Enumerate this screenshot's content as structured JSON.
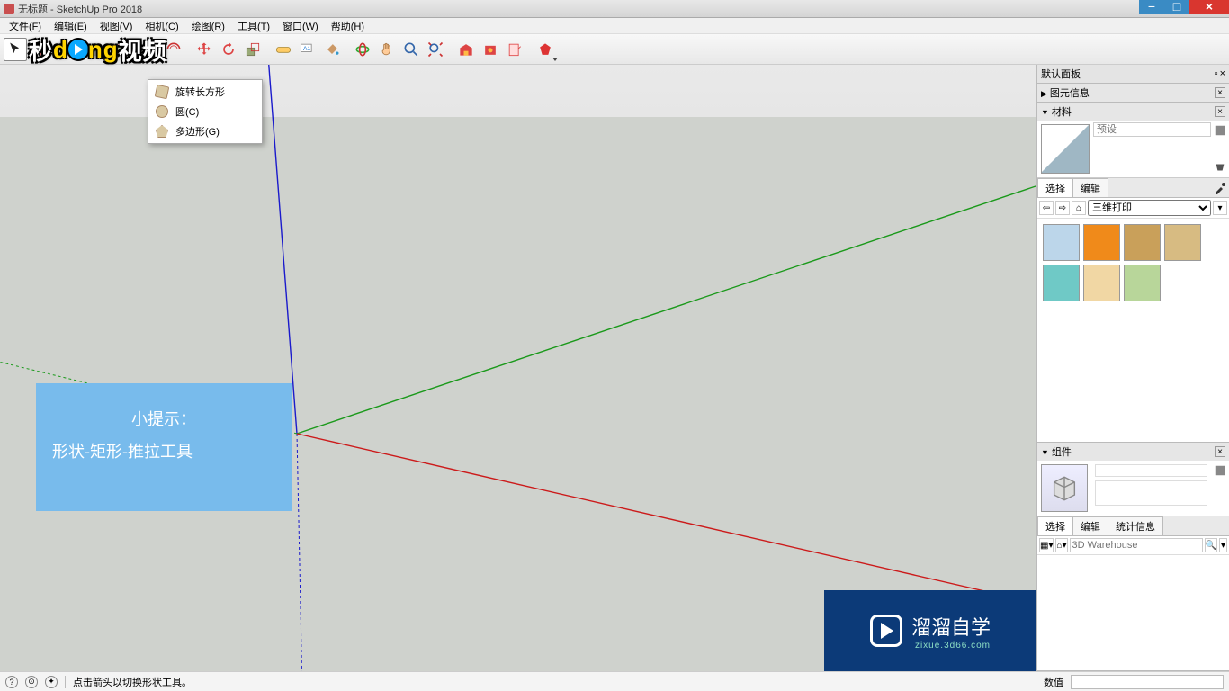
{
  "title": "无标题 - SketchUp Pro 2018",
  "menubar": [
    "文件(F)",
    "编辑(E)",
    "视图(V)",
    "相机(C)",
    "绘图(R)",
    "工具(T)",
    "窗口(W)",
    "帮助(H)"
  ],
  "dropdown": {
    "items": [
      {
        "label": "旋转长方形"
      },
      {
        "label": "圆(C)"
      },
      {
        "label": "多边形(G)"
      }
    ]
  },
  "tip": {
    "title": "小提示：",
    "body": "形状-矩形-推拉工具"
  },
  "tray": {
    "header": "默认面板",
    "entity_info": "图元信息",
    "materials": {
      "title": "材料",
      "preset_placeholder": "预设",
      "tabs": {
        "select": "选择",
        "edit": "编辑"
      },
      "collection": "三维打印",
      "swatches": [
        "#bcd6ea",
        "#f08a1a",
        "#c9a05a",
        "#d7bb82",
        "#6fc9c6",
        "#f1d7a4",
        "#b8d69a"
      ]
    },
    "components": {
      "title": "组件",
      "tabs": {
        "select": "选择",
        "edit": "编辑",
        "stats": "统计信息"
      },
      "search_placeholder": "3D Warehouse"
    }
  },
  "statusbar": {
    "hint": "点击箭头以切换形状工具。",
    "measure_label": "数值"
  },
  "overlay_logo": {
    "t1": "秒",
    "t2": "d",
    "t3": "ng",
    "t4": "视频"
  },
  "bottom_logo": {
    "big": "溜溜自学",
    "small": "zixue.3d66.com"
  }
}
